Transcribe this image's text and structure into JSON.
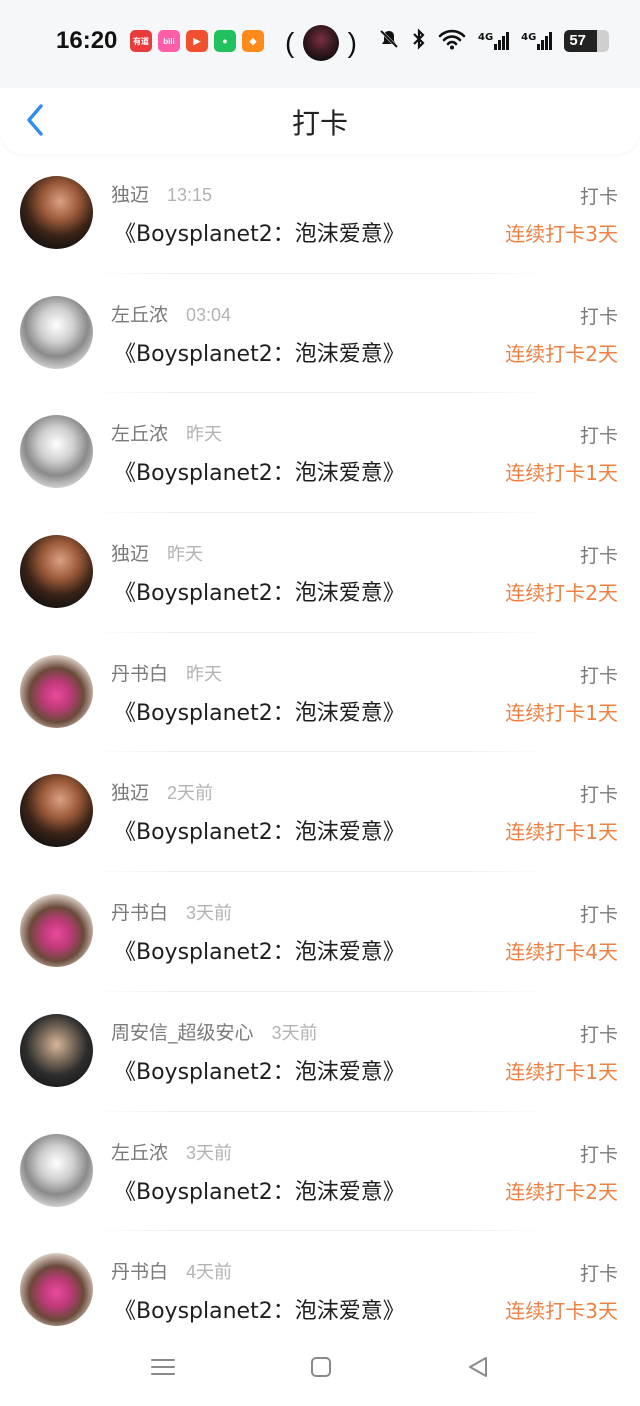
{
  "status_bar": {
    "time": "16:20",
    "apps": [
      {
        "icon": "youdao-icon",
        "label": "有道",
        "color": "#e93b3b"
      },
      {
        "icon": "bilibili-icon",
        "label": "bili",
        "color": "#ff5ea6"
      },
      {
        "icon": "video-icon",
        "label": "▶",
        "color": "#f0502e"
      },
      {
        "icon": "wechat-icon",
        "label": "●",
        "color": "#21c25e"
      },
      {
        "icon": "gift-icon",
        "label": "◆",
        "color": "#ff8a1a"
      }
    ],
    "network_labels": [
      "4G",
      "4G"
    ],
    "battery": "57"
  },
  "header": {
    "title": "打卡"
  },
  "checkins": [
    {
      "user": "独迈",
      "time": "13:15",
      "book": "《Boysplanet2：泡沫爱意》",
      "tag": "打卡",
      "streak": "连续打卡3天",
      "avatar": "a"
    },
    {
      "user": "左丘浓",
      "time": "03:04",
      "book": "《Boysplanet2：泡沫爱意》",
      "tag": "打卡",
      "streak": "连续打卡2天",
      "avatar": "b"
    },
    {
      "user": "左丘浓",
      "time": "昨天",
      "book": "《Boysplanet2：泡沫爱意》",
      "tag": "打卡",
      "streak": "连续打卡1天",
      "avatar": "b"
    },
    {
      "user": "独迈",
      "time": "昨天",
      "book": "《Boysplanet2：泡沫爱意》",
      "tag": "打卡",
      "streak": "连续打卡2天",
      "avatar": "a"
    },
    {
      "user": "丹书白",
      "time": "昨天",
      "book": "《Boysplanet2：泡沫爱意》",
      "tag": "打卡",
      "streak": "连续打卡1天",
      "avatar": "c"
    },
    {
      "user": "独迈",
      "time": "2天前",
      "book": "《Boysplanet2：泡沫爱意》",
      "tag": "打卡",
      "streak": "连续打卡1天",
      "avatar": "a"
    },
    {
      "user": "丹书白",
      "time": "3天前",
      "book": "《Boysplanet2：泡沫爱意》",
      "tag": "打卡",
      "streak": "连续打卡4天",
      "avatar": "c"
    },
    {
      "user": "周安信_超级安心",
      "time": "3天前",
      "book": "《Boysplanet2：泡沫爱意》",
      "tag": "打卡",
      "streak": "连续打卡1天",
      "avatar": "d"
    },
    {
      "user": "左丘浓",
      "time": "3天前",
      "book": "《Boysplanet2：泡沫爱意》",
      "tag": "打卡",
      "streak": "连续打卡2天",
      "avatar": "b"
    },
    {
      "user": "丹书白",
      "time": "4天前",
      "book": "《Boysplanet2：泡沫爱意》",
      "tag": "打卡",
      "streak": "连续打卡3天",
      "avatar": "c"
    }
  ],
  "colors": {
    "accent_back": "#2f8cf0",
    "streak": "#ee8042"
  },
  "system_nav": [
    "menu-icon",
    "home-icon",
    "back-triangle-icon"
  ]
}
